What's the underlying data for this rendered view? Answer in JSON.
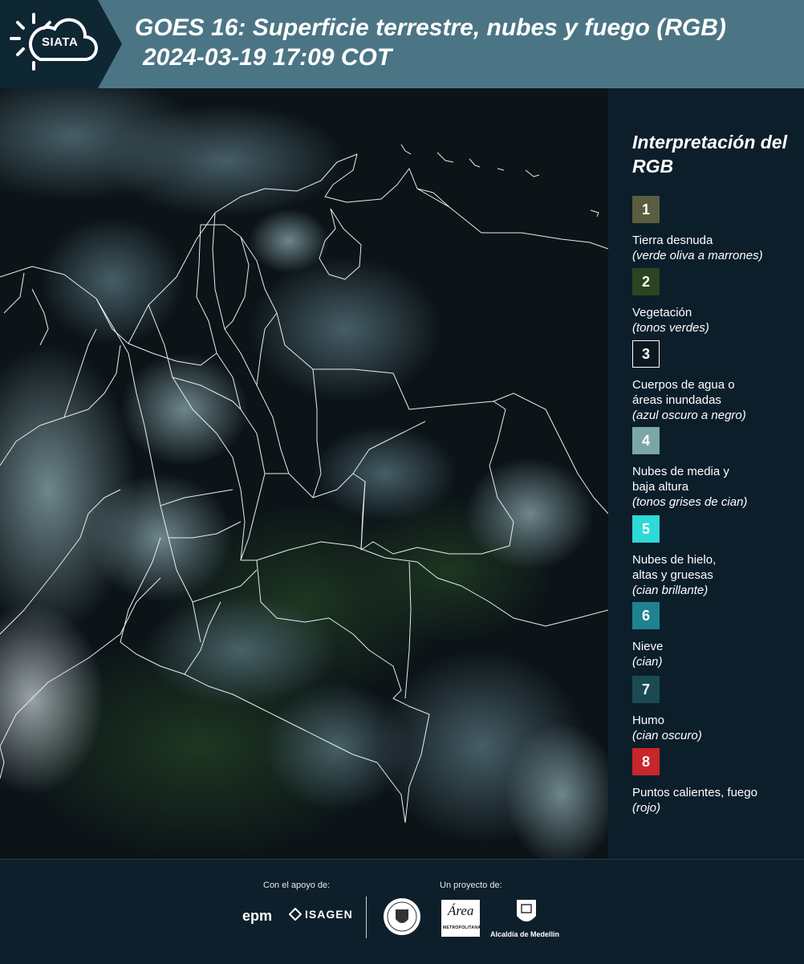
{
  "header": {
    "logo_text": "SIATA",
    "title_line1": "GOES 16: Superficie terrestre, nubes y fuego (RGB)",
    "title_line2": "2024-03-19 17:09 COT",
    "colors": {
      "dark_band": "#0f2633",
      "light_band": "#4b7585"
    }
  },
  "legend": {
    "title": "Interpretación del RGB",
    "items": [
      {
        "number": "1",
        "color": "#5b5d40",
        "label": "Tierra desnuda",
        "sub": "(verde oliva a marrones)"
      },
      {
        "number": "2",
        "color": "#2c4422",
        "label": "Vegetación",
        "sub": "(tonos verdes)"
      },
      {
        "number": "3",
        "color": "#0c1820",
        "label": "Cuerpos de agua o áreas inundadas",
        "sub": "(azul oscuro a negro)"
      },
      {
        "number": "4",
        "color": "#7aa7a6",
        "label": "Nubes de media y baja altura",
        "sub": "(tonos grises de cian)"
      },
      {
        "number": "5",
        "color": "#2ed9d9",
        "label": "Nubes de hielo, altas y gruesas",
        "sub": "(cian brillante)"
      },
      {
        "number": "6",
        "color": "#1e8290",
        "label": "Nieve",
        "sub": "(cian)"
      },
      {
        "number": "7",
        "color": "#1b4b52",
        "label": "Humo",
        "sub": "(cian oscuro)"
      },
      {
        "number": "8",
        "color": "#c7262a",
        "label": "Puntos calientes, fuego",
        "sub": "(rojo)"
      }
    ]
  },
  "footer": {
    "support_label": "Con el apoyo de:",
    "project_label": "Un proyecto de:",
    "epm": "epm",
    "isagen": "ISAGEN",
    "area_word": "Área",
    "area_small": "METROPOLITANA",
    "alcaldia": "Alcaldía de Medellín"
  }
}
